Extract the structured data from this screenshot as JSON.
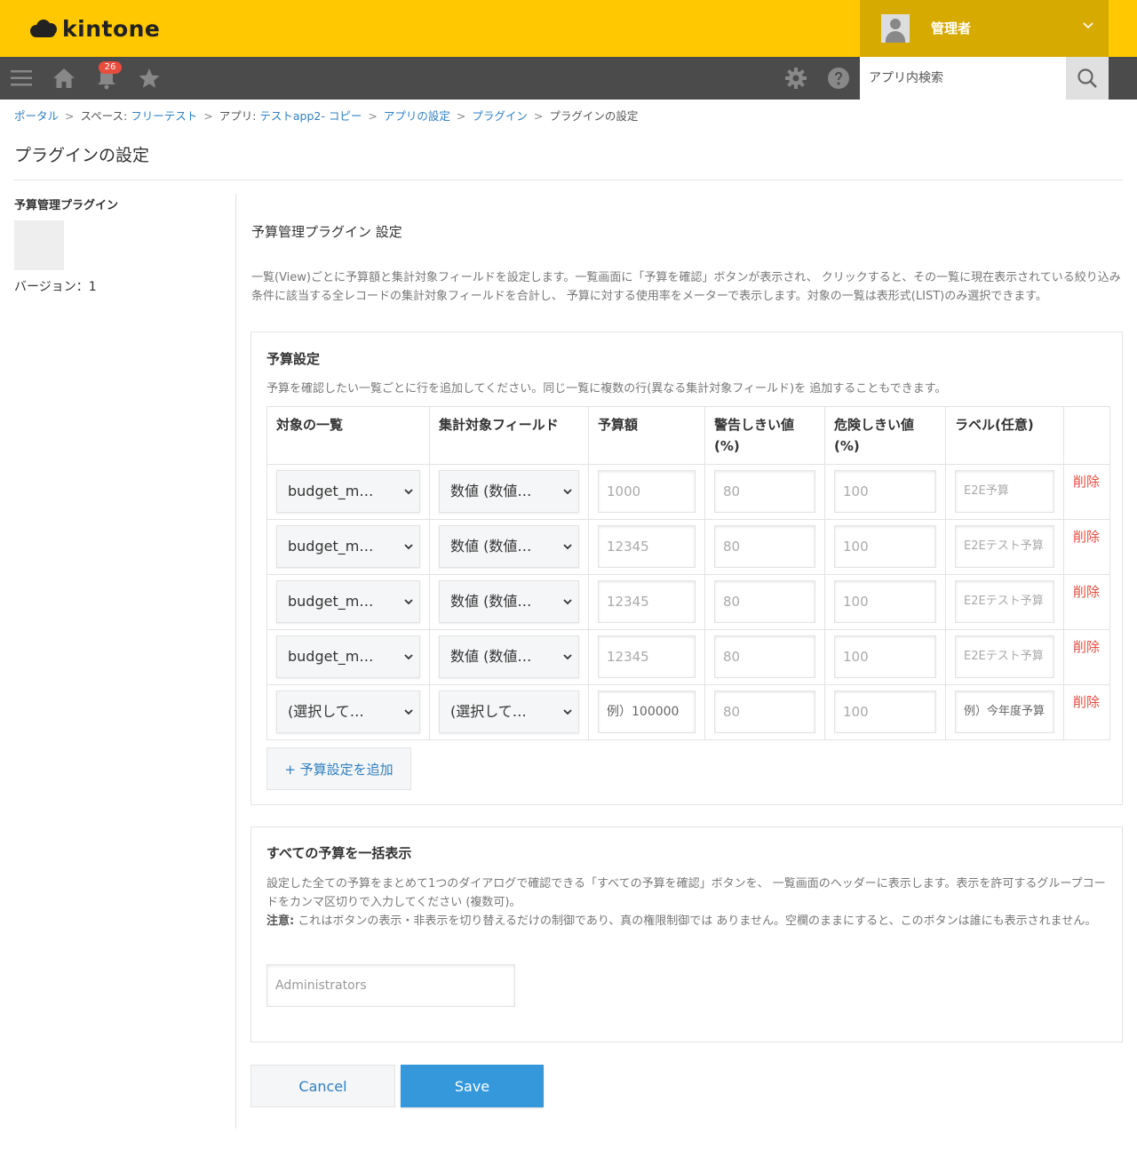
{
  "header": {
    "logo_text": "kintone",
    "user_name": "管理者",
    "notification_count": "26",
    "search_placeholder": "アプリ内検索"
  },
  "breadcrumb": {
    "portal": "ポータル",
    "space_prefix": "スペース: ",
    "space": "フリーテスト",
    "app_prefix": "アプリ: ",
    "app": "テストapp2- コピー",
    "app_settings": "アプリの設定",
    "plugins": "プラグイン",
    "current": "プラグインの設定",
    "separator": ">"
  },
  "page_title": "プラグインの設定",
  "sidebar": {
    "plugin_name": "予算管理プラグイン",
    "version": "バージョン：1"
  },
  "main": {
    "title": "予算管理プラグイン 設定",
    "description": "一覧(View)ごとに予算額と集計対象フィールドを設定します。一覧画面に「予算を確認」ボタンが表示され、 クリックすると、その一覧に現在表示されている絞り込み条件に該当する全レコードの集計対象フィールドを合計し、 予算に対する使用率をメーターで表示します。対象の一覧は表形式(LIST)のみ選択できます。"
  },
  "budget_panel": {
    "title": "予算設定",
    "description": "予算を確認したい一覧ごとに行を追加してください。同じ一覧に複数の行(異なる集計対象フィールド)を 追加することもできます。",
    "columns": [
      "対象の一覧",
      "集計対象フィールド",
      "予算額",
      "警告しきい値",
      "(%)",
      "危険しきい値",
      "(%)",
      "ラベル(任意)"
    ],
    "rows": [
      {
        "view": "budget_m…",
        "field": "数値 (数値…",
        "amount": "1000",
        "warn": "80",
        "danger": "100",
        "label": "E2E予算",
        "delete": "削除"
      },
      {
        "view": "budget_m…",
        "field": "数値 (数値…",
        "amount": "12345",
        "warn": "80",
        "danger": "100",
        "label": "E2Eテスト予算",
        "delete": "削除"
      },
      {
        "view": "budget_m…",
        "field": "数値 (数値…",
        "amount": "12345",
        "warn": "80",
        "danger": "100",
        "label": "E2Eテスト予算",
        "delete": "削除"
      },
      {
        "view": "budget_m…",
        "field": "数値 (数値…",
        "amount": "12345",
        "warn": "80",
        "danger": "100",
        "label": "E2Eテスト予算",
        "delete": "削除"
      },
      {
        "view": "(選択して…",
        "field": "(選択して…",
        "amount": "例）100000",
        "warn": "80",
        "danger": "100",
        "label": "例）今年度予算",
        "delete": "削除"
      }
    ],
    "add_button": "+ 予算設定を追加"
  },
  "all_panel": {
    "title": "すべての予算を一括表示",
    "description": "設定した全ての予算をまとめて1つのダイアログで確認できる「すべての予算を確認」ボタンを、 一覧画面のヘッダーに表示します。表示を許可するグループコードをカンマ区切りで入力してください (複数可)。",
    "note_label": "注意:",
    "note": " これはボタンの表示・非表示を切り替えるだけの制御であり、真の権限制御では ありません。空欄のままにすると、このボタンは誰にも表示されません。",
    "group_placeholder": "Administrators"
  },
  "buttons": {
    "cancel": "Cancel",
    "save": "Save"
  },
  "colors": {
    "header_yellow": "#ffc800",
    "user_area": "#d7aa00",
    "navbar": "#4b4b4b",
    "link_blue": "#2f7fc1",
    "save_blue": "#3498db",
    "delete_red": "#e74c3c"
  }
}
